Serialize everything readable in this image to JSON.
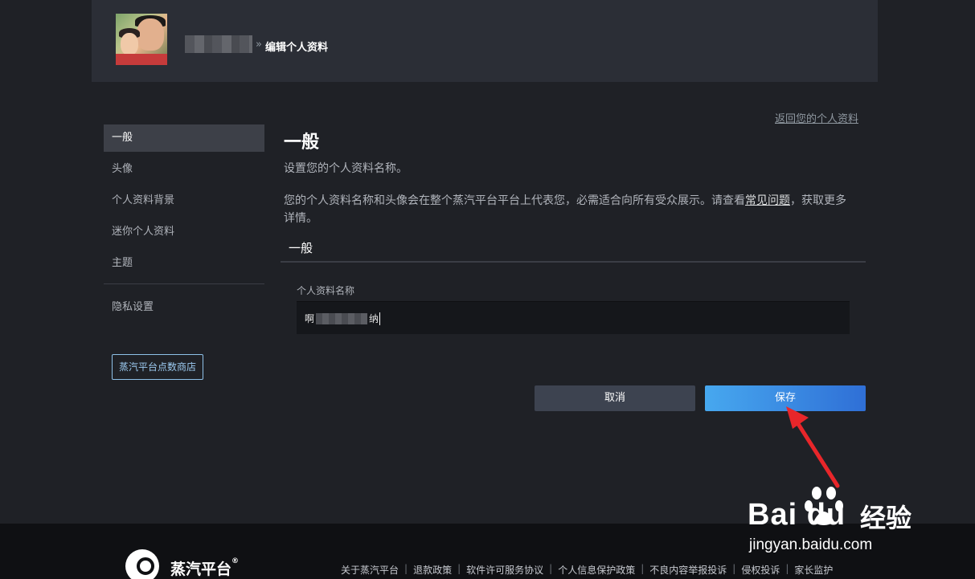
{
  "header": {
    "breadcrumb_sep": "»",
    "page_title": "编辑个人资料"
  },
  "return_link": "返回您的个人资料",
  "sidebar": {
    "items": [
      {
        "label": "一般",
        "active": true
      },
      {
        "label": "头像",
        "active": false
      },
      {
        "label": "个人资料背景",
        "active": false
      },
      {
        "label": "迷你个人资料",
        "active": false
      },
      {
        "label": "主题",
        "active": false
      }
    ],
    "privacy": "隐私设置",
    "store_button": "蒸汽平台点数商店"
  },
  "main": {
    "title": "一般",
    "subtitle": "设置您的个人资料名称。",
    "desc_before": "您的个人资料名称和头像会在整个蒸汽平台平台上代表您，必需适合向所有受众展示。请查看",
    "desc_link": "常见问题",
    "desc_after": "，获取更多详情。",
    "section": "一般",
    "field_label": "个人资料名称",
    "field_value_start": "啊",
    "field_value_end": "纳"
  },
  "buttons": {
    "cancel": "取消",
    "save": "保存"
  },
  "footer": {
    "brand": "蒸汽平台",
    "reg": "®",
    "links": [
      "关于蒸汽平台",
      "退款政策",
      "软件许可服务协议",
      "个人信息保护政策",
      "不良内容举报投诉",
      "侵权投诉",
      "家长监护"
    ]
  },
  "watermark": {
    "brand": "Bai du",
    "cn": "经验",
    "url": "jingyan.baidu.com"
  },
  "colors": {
    "accent_start": "#47a8ef",
    "accent_end": "#2f6fd6",
    "arrow": "#e8262a"
  }
}
